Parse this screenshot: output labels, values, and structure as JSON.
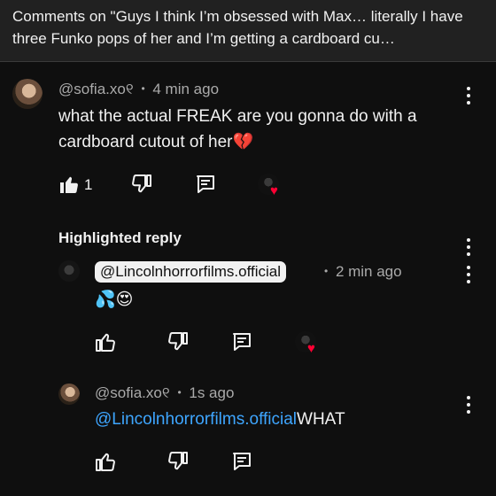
{
  "header": {
    "title": "Comments on \"Guys I think I’m obsessed with Max… literally I have three Funko pops of her and I’m getting a cardboard cu…"
  },
  "comment": {
    "author": "@sofia.xo୧",
    "time": "4 min ago",
    "text_main": "what the actual FREAK are you gonna do with a cardboard cutout of her",
    "text_emoji": "💔",
    "like_count": "1"
  },
  "highlighted": {
    "label": "Highlighted reply"
  },
  "reply1": {
    "author": "@Lincolnhorrorfilms.official",
    "time": "2 min ago",
    "text": "💦😍"
  },
  "reply2": {
    "author": "@sofia.xo୧",
    "time": "1s ago",
    "mention": "@Lincolnhorrorfilms.official",
    "text": "WHAT"
  },
  "meta_sep": "•",
  "icons": [
    "thumbs-up-icon",
    "thumbs-down-icon",
    "reply-icon",
    "creator-heart-icon",
    "more-vert-icon"
  ],
  "colors": {
    "background": "#0f0f0f",
    "header": "#212121",
    "link": "#3ea6ff",
    "heart": "#ff0033",
    "meta": "#aaaaaa"
  }
}
